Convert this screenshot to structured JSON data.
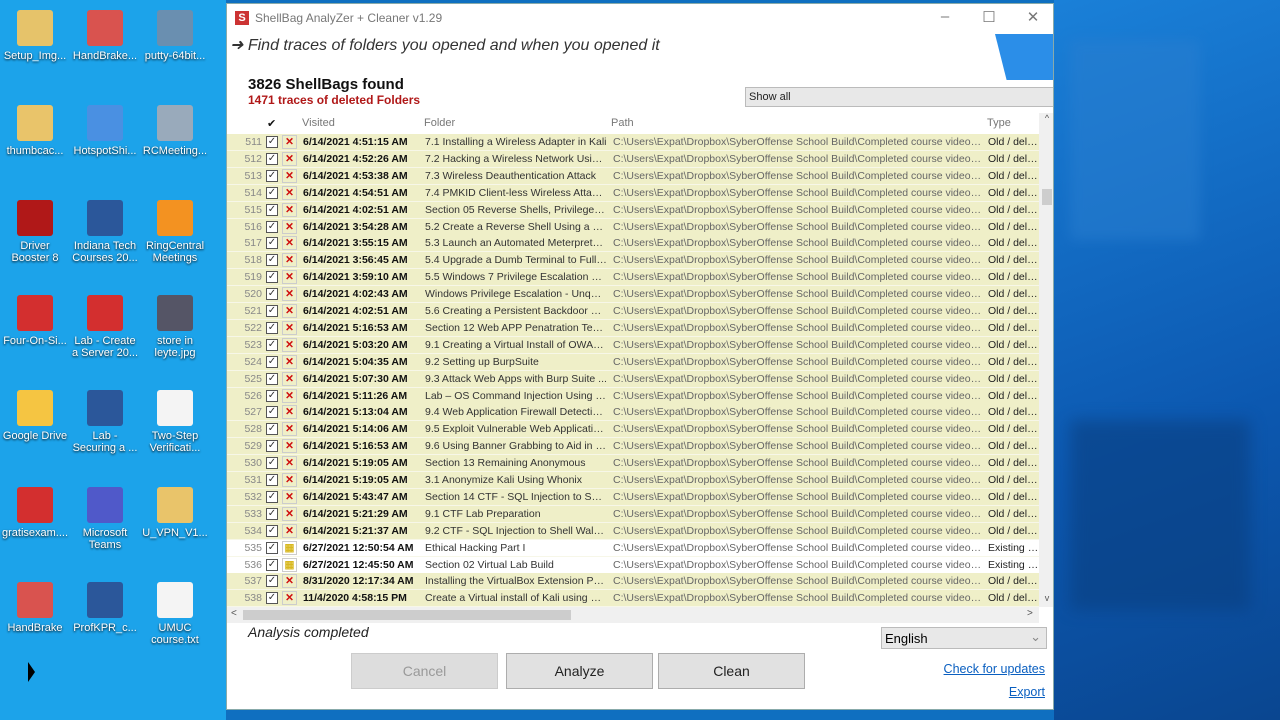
{
  "desktop": {
    "icons": [
      {
        "label": "Setup_Img...",
        "color": "#e6c36a"
      },
      {
        "label": "HandBrake...",
        "color": "#d9534f"
      },
      {
        "label": "putty-64bit...",
        "color": "#6a8fb0"
      },
      {
        "label": "thumbcac...",
        "color": "#e9c46a"
      },
      {
        "label": "HotspotShi...",
        "color": "#4a90e2"
      },
      {
        "label": "RCMeeting...",
        "color": "#99aabb"
      },
      {
        "label": "Driver Booster 8",
        "color": "#b01818"
      },
      {
        "label": "Indiana Tech Courses 20...",
        "color": "#2b579a"
      },
      {
        "label": "RingCentral Meetings",
        "color": "#f39221"
      },
      {
        "label": "Four-On-Si...",
        "color": "#d32f2f"
      },
      {
        "label": "Lab - Create a Server 20...",
        "color": "#d32f2f"
      },
      {
        "label": "store in leyte.jpg",
        "color": "#555566"
      },
      {
        "label": "Google Drive",
        "color": "#f5c542"
      },
      {
        "label": "Lab - Securing a ...",
        "color": "#2b579a"
      },
      {
        "label": "Two-Step Verificati...",
        "color": "#f4f4f4"
      },
      {
        "label": "gratisexam....",
        "color": "#d32f2f"
      },
      {
        "label": "Microsoft Teams",
        "color": "#5059c9"
      },
      {
        "label": "U_VPN_V1...",
        "color": "#e9c46a"
      },
      {
        "label": "HandBrake",
        "color": "#d9534f"
      },
      {
        "label": "ProfKPR_c...",
        "color": "#2b579a"
      },
      {
        "label": "UMUC course.txt",
        "color": "#f4f4f4"
      }
    ]
  },
  "window": {
    "title": "ShellBag  AnalyZer + Cleaner v1.29",
    "app_icon": "S",
    "minimize": "–",
    "maximize": "☐",
    "close": "✕"
  },
  "tagline": "➜ Find traces of folders you opened and when you opened it",
  "summary": {
    "count": "3826 ShellBags found",
    "deleted": "1471 traces of deleted Folders"
  },
  "filter": {
    "value": "Show all"
  },
  "table": {
    "headers": {
      "check": "✔",
      "visited": "Visited",
      "folder": "Folder",
      "path": "Path",
      "type": "Type"
    },
    "path": "C:\\Users\\Expat\\Dropbox\\SyberOffense School Build\\Completed course videos\\E...",
    "types": {
      "deleted": "Old / delete",
      "existing": "Existing Fol"
    },
    "rows": [
      [
        "511",
        "6/14/2021 4:51:15 AM",
        "7.1 Installing a Wireless Adapter in Kali",
        "deleted"
      ],
      [
        "512",
        "6/14/2021 4:52:26 AM",
        "7.2 Hacking a Wireless Network Using...",
        "deleted"
      ],
      [
        "513",
        "6/14/2021 4:53:38 AM",
        "7.3 Wireless Deauthentication Attack",
        "deleted"
      ],
      [
        "514",
        "6/14/2021 4:54:51 AM",
        "7.4 PMKID Client-less Wireless Attack ...",
        "deleted"
      ],
      [
        "515",
        "6/14/2021 4:02:51 AM",
        "Section 05 Reverse Shells, Privilege E...",
        "deleted"
      ],
      [
        "516",
        "6/14/2021 3:54:28 AM",
        "5.2 Create a Reverse Shell Using a Fil...",
        "deleted"
      ],
      [
        "517",
        "6/14/2021 3:55:15 AM",
        "5.3 Launch an Automated Meterpreter...",
        "deleted"
      ],
      [
        "518",
        "6/14/2021 3:56:45 AM",
        "5.4 Upgrade a Dumb Terminal to Fully ...",
        "deleted"
      ],
      [
        "519",
        "6/14/2021 3:59:10 AM",
        "5.5 Windows 7 Privilege Escalation Us...",
        "deleted"
      ],
      [
        "520",
        "6/14/2021 4:02:43 AM",
        "Windows Privilege Escalation - Unquo...",
        "deleted"
      ],
      [
        "521",
        "6/14/2021 4:02:51 AM",
        "5.6 Creating a Persistent Backdoor Us...",
        "deleted"
      ],
      [
        "522",
        "6/14/2021 5:16:53 AM",
        "Section 12 Web APP Penatration Testi...",
        "deleted"
      ],
      [
        "523",
        "6/14/2021 5:03:20 AM",
        "9.1 Creating a Virtual Install of OWASP",
        "deleted"
      ],
      [
        "524",
        "6/14/2021 5:04:35 AM",
        "9.2 Setting up BurpSuite",
        "deleted"
      ],
      [
        "525",
        "6/14/2021 5:07:30 AM",
        "9.3 Attack Web Apps with Burp Suite ...",
        "deleted"
      ],
      [
        "526",
        "6/14/2021 5:11:26 AM",
        "Lab – OS Command Injection Using Co...",
        "deleted"
      ],
      [
        "527",
        "6/14/2021 5:13:04 AM",
        "9.4 Web Application Firewall Detection...",
        "deleted"
      ],
      [
        "528",
        "6/14/2021 5:14:06 AM",
        "9.5 Exploit Vulnerable Web Application...",
        "deleted"
      ],
      [
        "529",
        "6/14/2021 5:16:53 AM",
        "9.6 Using Banner Grabbing to Aid in R...",
        "deleted"
      ],
      [
        "530",
        "6/14/2021 5:19:05 AM",
        "Section 13 Remaining Anonymous",
        "deleted"
      ],
      [
        "531",
        "6/14/2021 5:19:05 AM",
        "3.1 Anonymize Kali Using Whonix",
        "deleted"
      ],
      [
        "532",
        "6/14/2021 5:43:47 AM",
        "Section 14 CTF - SQL Injection to Shell...",
        "deleted"
      ],
      [
        "533",
        "6/14/2021 5:21:29 AM",
        "9.1 CTF Lab Preparation",
        "deleted"
      ],
      [
        "534",
        "6/14/2021 5:21:37 AM",
        "9.2 CTF - SQL Injection to Shell Walkth...",
        "deleted"
      ],
      [
        "535",
        "6/27/2021 12:50:54 AM",
        "Ethical Hacking Part I",
        "existing"
      ],
      [
        "536",
        "6/27/2021 12:45:50 AM",
        "Section 02 Virtual Lab Build",
        "existing"
      ],
      [
        "537",
        "8/31/2020 12:17:34 AM",
        "Installing the VirtualBox Extension Pack",
        "deleted"
      ],
      [
        "538",
        "11/4/2020 4:58:15 PM",
        "Create a Virtual install of Kali using Vir...",
        "deleted"
      ]
    ]
  },
  "scroll": {
    "up": "^",
    "down": "v",
    "left": "<",
    "right": ">"
  },
  "status": "Analysis completed",
  "language": {
    "value": "English",
    "arrow": "⌄"
  },
  "buttons": {
    "cancel": "Cancel",
    "analyze": "Analyze",
    "clean": "Clean"
  },
  "links": {
    "updates": "Check for updates",
    "export": "Export"
  },
  "colors": {
    "deleted_row": "#efefc8",
    "deleted_text": "#b01818",
    "link": "#0a5fc0"
  }
}
